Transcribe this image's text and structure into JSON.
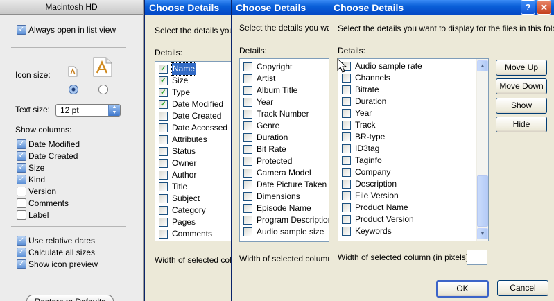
{
  "mac": {
    "title": "Macintosh HD",
    "always_open_list": {
      "label": "Always open in list view",
      "checked": true
    },
    "icon_size_label": "Icon size:",
    "text_size_label": "Text size:",
    "text_size_value": "12 pt",
    "show_columns_label": "Show columns:",
    "columns": [
      {
        "label": "Date Modified",
        "checked": true
      },
      {
        "label": "Date Created",
        "checked": true
      },
      {
        "label": "Size",
        "checked": true
      },
      {
        "label": "Kind",
        "checked": true
      },
      {
        "label": "Version",
        "checked": false
      },
      {
        "label": "Comments",
        "checked": false
      },
      {
        "label": "Label",
        "checked": false
      }
    ],
    "options": [
      {
        "label": "Use relative dates",
        "checked": true
      },
      {
        "label": "Calculate all sizes",
        "checked": true
      },
      {
        "label": "Show icon preview",
        "checked": true
      }
    ],
    "restore_button": "Restore to Defaults"
  },
  "win1": {
    "title": "Choose Details",
    "instruction": "Select the details you w",
    "details_label": "Details:",
    "items": [
      {
        "label": "Name",
        "checked": true,
        "selected": true
      },
      {
        "label": "Size",
        "checked": true
      },
      {
        "label": "Type",
        "checked": true
      },
      {
        "label": "Date Modified",
        "checked": true
      },
      {
        "label": "Date Created",
        "checked": false
      },
      {
        "label": "Date Accessed",
        "checked": false
      },
      {
        "label": "Attributes",
        "checked": false
      },
      {
        "label": "Status",
        "checked": false
      },
      {
        "label": "Owner",
        "checked": false
      },
      {
        "label": "Author",
        "checked": false
      },
      {
        "label": "Title",
        "checked": false
      },
      {
        "label": "Subject",
        "checked": false
      },
      {
        "label": "Category",
        "checked": false
      },
      {
        "label": "Pages",
        "checked": false
      },
      {
        "label": "Comments",
        "checked": false
      }
    ],
    "width_label": "Width of selected colum"
  },
  "win2": {
    "title": "Choose Details",
    "instruction": "Select the details you want",
    "details_label": "Details:",
    "items": [
      {
        "label": "Copyright",
        "checked": false
      },
      {
        "label": "Artist",
        "checked": false
      },
      {
        "label": "Album Title",
        "checked": false
      },
      {
        "label": "Year",
        "checked": false
      },
      {
        "label": "Track Number",
        "checked": false
      },
      {
        "label": "Genre",
        "checked": false
      },
      {
        "label": "Duration",
        "checked": false
      },
      {
        "label": "Bit Rate",
        "checked": false
      },
      {
        "label": "Protected",
        "checked": false
      },
      {
        "label": "Camera Model",
        "checked": false
      },
      {
        "label": "Date Picture Taken",
        "checked": false
      },
      {
        "label": "Dimensions",
        "checked": false
      },
      {
        "label": "Episode Name",
        "checked": false
      },
      {
        "label": "Program Description",
        "checked": false
      },
      {
        "label": "Audio sample size",
        "checked": false
      }
    ],
    "width_label": "Width of selected column (ir"
  },
  "win3": {
    "title": "Choose Details",
    "instruction": "Select the details you want to display for the files in this folder.",
    "details_label": "Details:",
    "items": [
      {
        "label": "Audio sample rate",
        "checked": false
      },
      {
        "label": "Channels",
        "checked": false
      },
      {
        "label": "Bitrate",
        "checked": false
      },
      {
        "label": "Duration",
        "checked": false
      },
      {
        "label": "Year",
        "checked": false
      },
      {
        "label": "Track",
        "checked": false
      },
      {
        "label": "BR-type",
        "checked": false
      },
      {
        "label": "ID3tag",
        "checked": false
      },
      {
        "label": "Taginfo",
        "checked": false
      },
      {
        "label": "Company",
        "checked": false
      },
      {
        "label": "Description",
        "checked": false
      },
      {
        "label": "File Version",
        "checked": false
      },
      {
        "label": "Product Name",
        "checked": false
      },
      {
        "label": "Product Version",
        "checked": false
      },
      {
        "label": "Keywords",
        "checked": false
      }
    ],
    "buttons": {
      "move_up": "Move Up",
      "move_down": "Move Down",
      "show": "Show",
      "hide": "Hide",
      "ok": "OK",
      "cancel": "Cancel"
    },
    "width_label": "Width of selected column (in pixels):",
    "width_value": "",
    "help_glyph": "?",
    "close_glyph": "✕"
  },
  "colors": {
    "xp_title": "#0346c4",
    "selection": "#316ac5",
    "dialog_bg": "#ece9d8"
  }
}
